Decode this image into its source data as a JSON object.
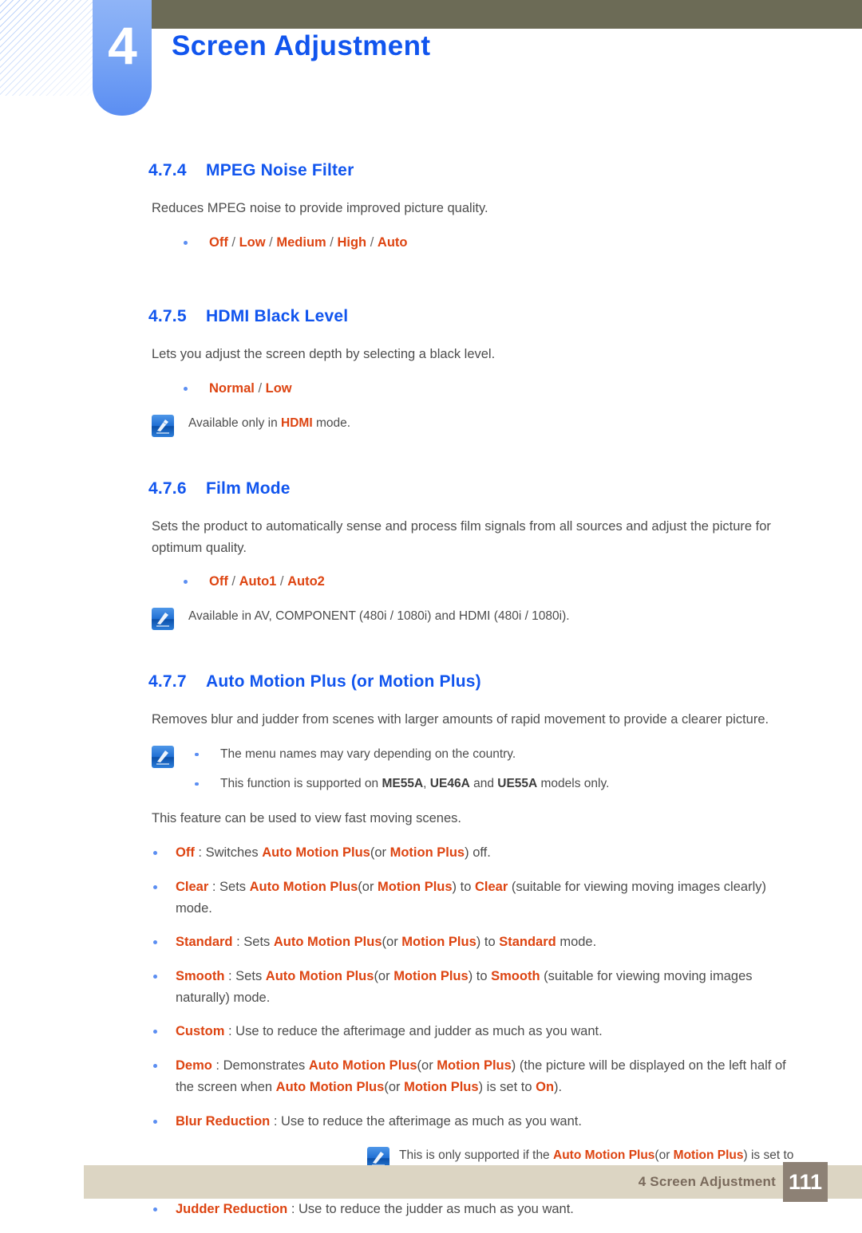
{
  "header": {
    "chapter_number": "4",
    "chapter_title": "Screen Adjustment"
  },
  "sections": [
    {
      "number": "4.7.4",
      "title": "MPEG Noise Filter",
      "body": "Reduces MPEG noise to provide improved picture quality.",
      "options_line": "Off / Low / Medium / High / Auto"
    },
    {
      "number": "4.7.5",
      "title": "HDMI Black Level",
      "body": "Lets you adjust the screen depth by selecting a black level.",
      "options_line": "Normal / Low",
      "note": "Available only in HDMI mode."
    },
    {
      "number": "4.7.6",
      "title": "Film Mode",
      "body": "Sets the product to automatically sense and process film signals from all sources and adjust the picture for optimum quality.",
      "options_line": "Off / Auto1 / Auto2",
      "note": "Available in AV, COMPONENT (480i / 1080i) and HDMI (480i / 1080i)."
    },
    {
      "number": "4.7.7",
      "title": "Auto Motion Plus (or Motion Plus)",
      "body": "Removes blur and judder from scenes with larger amounts of rapid movement to provide a clearer picture.",
      "notes": [
        "The menu names may vary depending on the country.",
        "This function is supported on ME55A, UE46A and UE55A models only."
      ],
      "body2": "This feature can be used to view fast moving scenes."
    }
  ],
  "mpeg_options": {
    "off": "Off",
    "low": "Low",
    "medium": "Medium",
    "high": "High",
    "auto": "Auto",
    "slash": " / "
  },
  "hdmi_options": {
    "normal": "Normal",
    "low": "Low"
  },
  "film_options": {
    "off": "Off",
    "auto1": "Auto1",
    "auto2": "Auto2"
  },
  "hdmi_note": {
    "before": "Available only in ",
    "term": "HDMI",
    "after": " mode."
  },
  "film_note": "Available in AV, COMPONENT (480i / 1080i) and HDMI (480i / 1080i).",
  "amp_notes": {
    "note1": "The menu names may vary depending on the country.",
    "note2_before": "This function is supported on ",
    "note2_m1": "ME55A",
    "note2_comma": ", ",
    "note2_m2": "UE46A",
    "note2_and": " and ",
    "note2_m3": "UE55A",
    "note2_after": " models only."
  },
  "amp_intro": "This feature can be used to view fast moving scenes.",
  "terms": {
    "auto_motion_plus": "Auto Motion Plus",
    "motion_plus": "Motion Plus",
    "or_open": "(or ",
    "close_paren": ")",
    "off": "Off",
    "clear": "Clear",
    "standard": "Standard",
    "smooth": "Smooth",
    "custom": "Custom",
    "demo": "Demo",
    "on": "On",
    "blur_reduction": "Blur Reduction",
    "judder_reduction": "Judder Reduction",
    "colon": " : "
  },
  "amp_bullets": {
    "off_text1": " : Switches ",
    "off_text2": " off.",
    "clear_text1": " : Sets ",
    "clear_text2": " to ",
    "clear_text3": " (suitable for viewing moving images clearly) mode.",
    "standard_text1": " : Sets ",
    "standard_text2": " to ",
    "standard_text3": " mode.",
    "smooth_text1": " : Sets ",
    "smooth_text2": " to ",
    "smooth_text3": " (suitable for viewing moving images naturally) mode.",
    "custom_text": " : Use to reduce the afterimage and judder as much as you want.",
    "demo_text1": " : Demonstrates ",
    "demo_text2": " (the picture will be displayed on the left half of the screen when ",
    "demo_text3": " is set to ",
    "demo_text4": ").",
    "blur_text": " : Use to reduce the afterimage as much as you want.",
    "judder_text": " : Use to reduce the judder as much as you want."
  },
  "blur_note": {
    "before": "This is only supported if the ",
    "middle": " is set to ",
    "after": "."
  },
  "footer": {
    "label": "4 Screen Adjustment",
    "page": "111"
  },
  "colors": {
    "heading_blue": "#1155ee",
    "highlight_orange": "#dd4411",
    "olive_bar": "#6c6b56",
    "tab_blue": "#5b8ef2",
    "footer_bar": "#dcd5c3",
    "page_box": "#8d8175",
    "body_text": "#4d4d4d"
  }
}
